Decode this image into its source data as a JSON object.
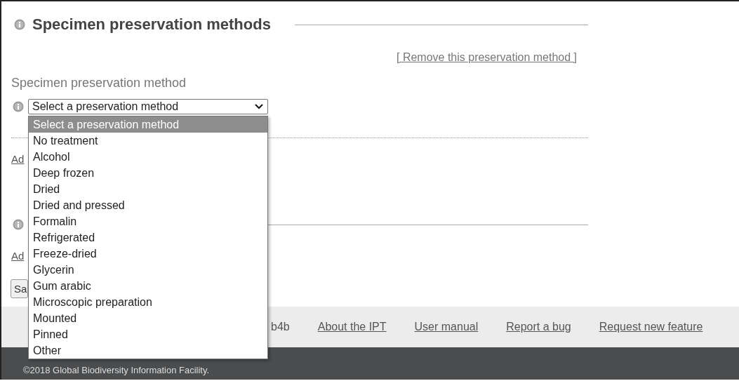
{
  "section": {
    "title": "Specimen preservation methods",
    "remove_link": "[ Remove this preservation method ]",
    "field_label": "Specimen preservation method",
    "select": {
      "value": "Select a preservation method",
      "expanded": true
    }
  },
  "dropdown": {
    "options": [
      {
        "label": "Select a preservation method",
        "selected": true
      },
      {
        "label": "No treatment",
        "selected": false
      },
      {
        "label": "Alcohol",
        "selected": false
      },
      {
        "label": "Deep frozen",
        "selected": false
      },
      {
        "label": "Dried",
        "selected": false
      },
      {
        "label": "Dried and pressed",
        "selected": false
      },
      {
        "label": "Formalin",
        "selected": false
      },
      {
        "label": "Refrigerated",
        "selected": false
      },
      {
        "label": "Freeze-dried",
        "selected": false
      },
      {
        "label": "Glycerin",
        "selected": false
      },
      {
        "label": "Gum arabic",
        "selected": false
      },
      {
        "label": "Microscopic preparation",
        "selected": false
      },
      {
        "label": "Mounted",
        "selected": false
      },
      {
        "label": "Pinned",
        "selected": false
      },
      {
        "label": "Other",
        "selected": false
      }
    ]
  },
  "add_link_1": "Ad",
  "add_link_2": "Ad",
  "save_button": "Sa",
  "footer": {
    "version": "b4b",
    "links": [
      "About the IPT",
      "User manual",
      "Report a bug",
      "Request new feature"
    ],
    "copyright": "©2018 Global Biodiversity Information Facility."
  }
}
